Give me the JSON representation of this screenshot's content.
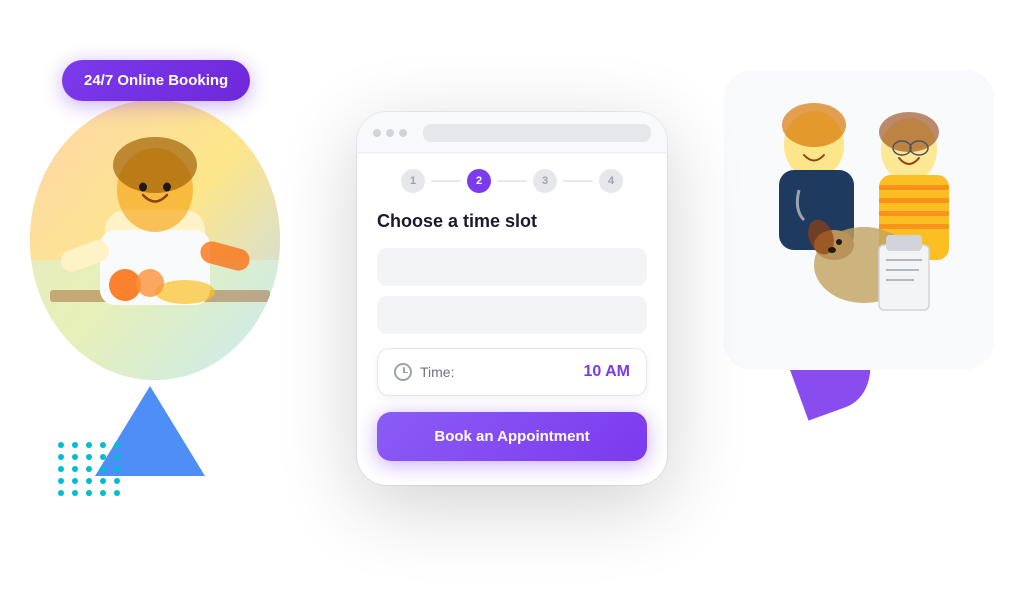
{
  "badge": {
    "label": "24/7 Online Booking"
  },
  "phone": {
    "dots": [
      "dot1",
      "dot2",
      "dot3"
    ],
    "steps": [
      {
        "number": "1",
        "state": "inactive"
      },
      {
        "number": "2",
        "state": "active"
      },
      {
        "number": "3",
        "state": "inactive"
      },
      {
        "number": "4",
        "state": "inactive"
      }
    ],
    "title": "Choose a time slot",
    "time_label": "Time:",
    "time_value": "10 AM",
    "book_button": "Book an Appointment"
  },
  "decorations": {
    "dots_color": "#00bcd4",
    "ring_color": "#00e5c8",
    "purple_shape_color": "#7c3aed",
    "triangle_color": "#3b82f6"
  }
}
